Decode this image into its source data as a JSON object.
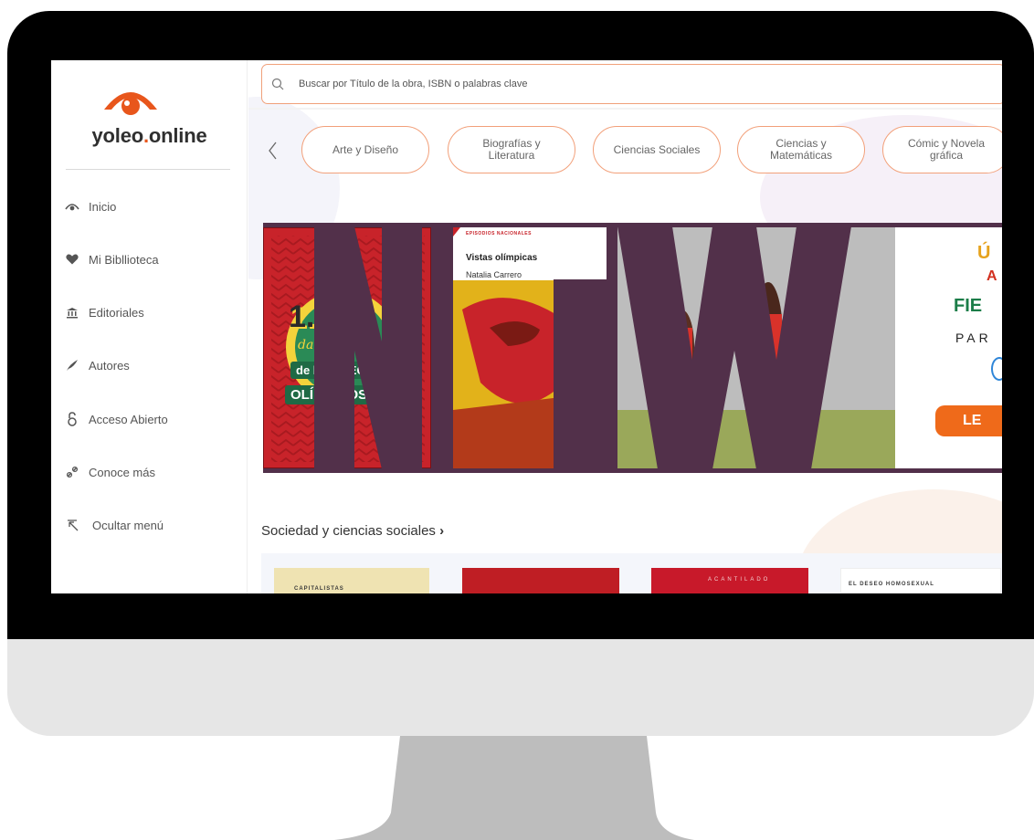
{
  "brand": {
    "name_main": "yoleo",
    "name_dot": ".",
    "name_tld": "online",
    "accent": "#e8561c"
  },
  "search": {
    "placeholder": "Buscar por Título de la obra, ISBN o palabras clave"
  },
  "sidebar": {
    "items": [
      {
        "label": "Inicio",
        "icon": "eye-logo-icon"
      },
      {
        "label": "Mi Bibllioteca",
        "icon": "heart-icon"
      },
      {
        "label": "Editoriales",
        "icon": "institution-icon"
      },
      {
        "label": "Autores",
        "icon": "quill-icon"
      },
      {
        "label": "Acceso Abierto",
        "icon": "open-lock-icon"
      },
      {
        "label": "Conoce más",
        "icon": "link-icon"
      },
      {
        "label": "Ocultar menú",
        "icon": "collapse-arrow-icon"
      }
    ]
  },
  "categories": [
    {
      "line1": "Arte y Diseño",
      "line2": ""
    },
    {
      "line1": "Biografías y",
      "line2": "Literatura"
    },
    {
      "line1": "Ciencias Sociales",
      "line2": ""
    },
    {
      "line1": "Ciencias y",
      "line2": "Matemáticas"
    },
    {
      "line1": "Cómic y Novela",
      "line2": "gráfica"
    }
  ],
  "banner": {
    "book1": {
      "line1": "1.000",
      "line2": "datos locos",
      "line3": "de los JUEGOS",
      "line4": "OLÍMPICOS"
    },
    "book2": {
      "series": "EPISODIOS NACIONALES",
      "title": "Vistas olímpicas",
      "author": "Natalia Carrero"
    },
    "ad": {
      "l1": "Ú",
      "l2": "A",
      "l3": "FIE",
      "l4": "PAR",
      "button": "LE"
    }
  },
  "section": {
    "title": "Sociedad y ciencias sociales",
    "arrow": "›"
  },
  "books_row": [
    {
      "label": "CAPITALISTAS"
    },
    {
      "label": ""
    },
    {
      "label": "ACANTILADO"
    },
    {
      "label": "EL DESEO HOMOSEXUAL"
    }
  ],
  "colors": {
    "pill_border": "#f2a07a",
    "banner_bg": "#52304a"
  }
}
